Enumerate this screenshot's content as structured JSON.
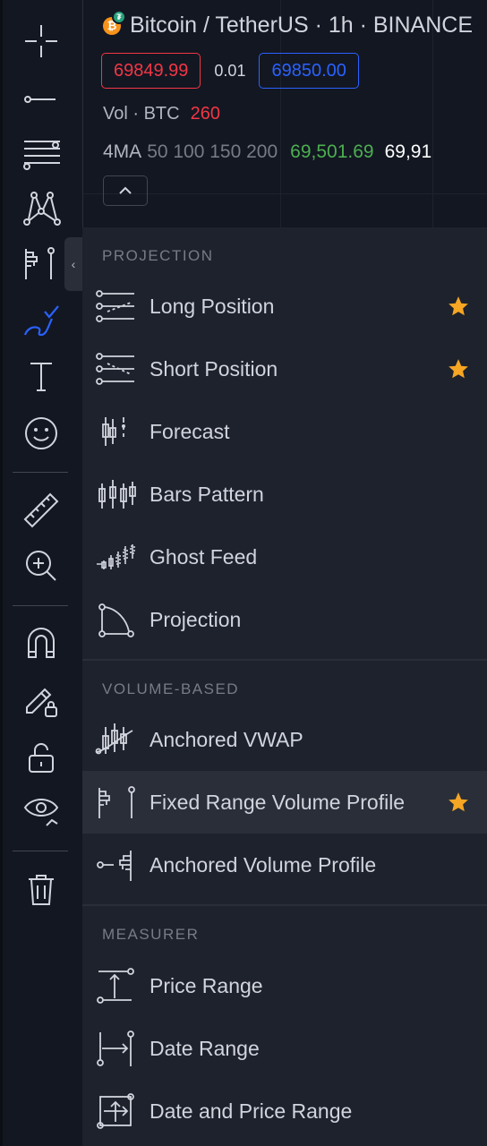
{
  "chart_header": {
    "symbol_title": "Bitcoin / TetherUS · 1h · BINANCE",
    "base_glyph": "₿",
    "quote_glyph": "₮",
    "sell_price": "69849.99",
    "spread": "0.01",
    "buy_price": "69850.00",
    "volume_label": "Vol · BTC",
    "volume_value": "260",
    "ma_label": "4MA",
    "ma_params": "50 100 150 200",
    "ma_value_1": "69,501.69",
    "ma_value_2": "69,91"
  },
  "toolbar": {
    "collapse_glyph": "‹",
    "tools": [
      "crosshair",
      "trend-line",
      "fib-levels",
      "patterns",
      "prediction-measurement",
      "brush",
      "text",
      "emoji",
      "ruler",
      "zoom-in",
      "magnet",
      "lock-drawing",
      "lock",
      "hide-drawings",
      "trash"
    ]
  },
  "menu": {
    "sections": [
      {
        "title": "PROJECTION",
        "items": [
          {
            "label": "Long Position",
            "icon": "long-position-icon",
            "starred": true
          },
          {
            "label": "Short Position",
            "icon": "short-position-icon",
            "starred": true
          },
          {
            "label": "Forecast",
            "icon": "forecast-icon",
            "starred": false
          },
          {
            "label": "Bars Pattern",
            "icon": "bars-pattern-icon",
            "starred": false
          },
          {
            "label": "Ghost Feed",
            "icon": "ghost-feed-icon",
            "starred": false
          },
          {
            "label": "Projection",
            "icon": "projection-icon",
            "starred": false
          }
        ]
      },
      {
        "title": "VOLUME-BASED",
        "items": [
          {
            "label": "Anchored VWAP",
            "icon": "anchored-vwap-icon",
            "starred": false
          },
          {
            "label": "Fixed Range Volume Profile",
            "icon": "fixed-range-volume-profile-icon",
            "starred": true,
            "active": true
          },
          {
            "label": "Anchored Volume Profile",
            "icon": "anchored-volume-profile-icon",
            "starred": false
          }
        ]
      },
      {
        "title": "MEASURER",
        "items": [
          {
            "label": "Price Range",
            "icon": "price-range-icon",
            "starred": false
          },
          {
            "label": "Date Range",
            "icon": "date-range-icon",
            "starred": false
          },
          {
            "label": "Date and Price Range",
            "icon": "date-price-range-icon",
            "starred": false
          }
        ]
      }
    ]
  },
  "colors": {
    "background": "#131722",
    "menu_background": "#1e222d",
    "active_item": "#2a2e39",
    "accent_blue": "#2962ff",
    "sell_red": "#f23645",
    "ma_green": "#4caf50",
    "star": "#f6a623",
    "text": "#d1d4dc",
    "muted": "#787b86"
  }
}
